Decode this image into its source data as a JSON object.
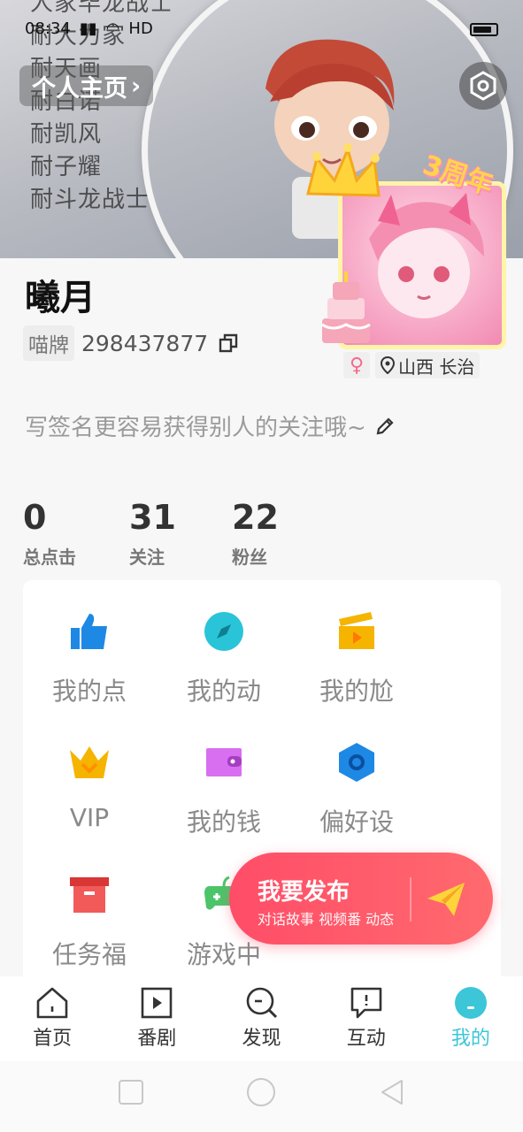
{
  "status_bar": {
    "time": "08:34",
    "network": "HD"
  },
  "banner": {
    "background_lines": [
      "人家毕龙战士",
      "耐大力家",
      "耐天画",
      "耐白诺",
      "耐凯风",
      "耐子耀",
      "耐斗龙战士"
    ]
  },
  "header": {
    "home_link": "个人主页",
    "home_chevron": "›"
  },
  "avatar": {
    "anniversary": "3周年"
  },
  "profile": {
    "name": "曦月",
    "id_tag": "喵牌",
    "id_number": "298437877",
    "gender_symbol": "♀",
    "location": "山西 长治",
    "signature": "写签名更容易获得别人的关注哦~"
  },
  "stats": [
    {
      "value": "0",
      "label": "总点击"
    },
    {
      "value": "31",
      "label": "关注"
    },
    {
      "value": "22",
      "label": "粉丝"
    }
  ],
  "grid": [
    {
      "label": "我的点",
      "icon": "thumbs-up-icon",
      "color": "#1e88e5"
    },
    {
      "label": "我的动",
      "icon": "compass-icon",
      "color": "#29c4d8"
    },
    {
      "label": "我的尬",
      "icon": "clapperboard-icon",
      "color": "#f5b400"
    },
    {
      "label": "VIP",
      "icon": "crown-icon",
      "color": "#f5b400"
    },
    {
      "label": "我的钱",
      "icon": "wallet-icon",
      "color": "#d86ef0"
    },
    {
      "label": "偏好设",
      "icon": "hexagon-settings-icon",
      "color": "#1e88e5"
    },
    {
      "label": "任务福",
      "icon": "gift-box-icon",
      "color": "#f25a5a"
    },
    {
      "label": "游戏中",
      "icon": "gamepad-icon",
      "color": "#4cc46a"
    }
  ],
  "publish": {
    "title": "我要发布",
    "subtitle": "对话故事 视频番 动态"
  },
  "bottom_nav": [
    {
      "label": "首页",
      "icon": "home-icon",
      "active": false
    },
    {
      "label": "番剧",
      "icon": "play-icon",
      "active": false
    },
    {
      "label": "发现",
      "icon": "search-icon",
      "active": false
    },
    {
      "label": "互动",
      "icon": "chat-icon",
      "active": false
    },
    {
      "label": "我的",
      "icon": "profile-icon",
      "active": true
    }
  ],
  "colors": {
    "accent": "#3cc6d8",
    "publish": "#ff4d68"
  }
}
